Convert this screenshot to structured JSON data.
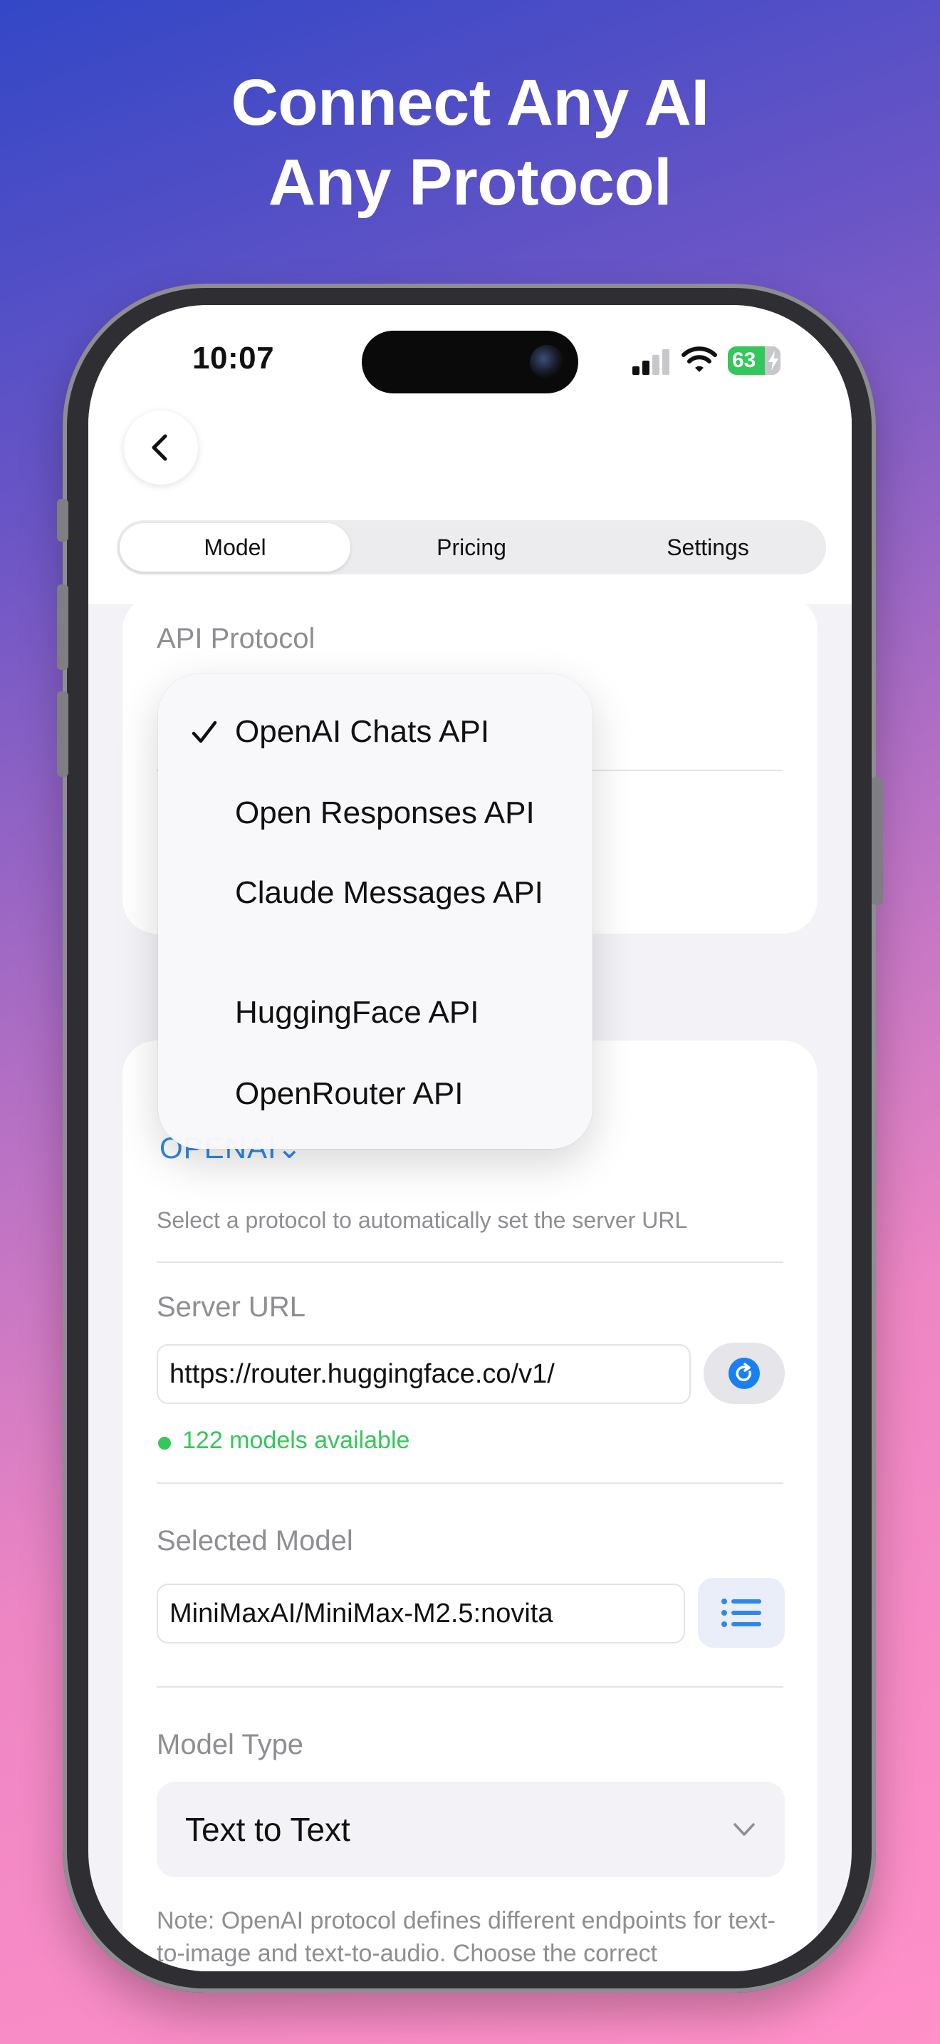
{
  "headline": {
    "line1": "Connect Any AI",
    "line2": "Any Protocol"
  },
  "status_bar": {
    "time": "10:07",
    "battery": "63"
  },
  "tabs": [
    {
      "label": "Model",
      "selected": true
    },
    {
      "label": "Pricing",
      "selected": false
    },
    {
      "label": "Settings",
      "selected": false
    }
  ],
  "api_protocol": {
    "label": "API Protocol",
    "selected_preset": "OPENAI",
    "preset_hint": "Select a protocol to automatically set the server URL"
  },
  "protocol_menu": {
    "items": [
      {
        "label": "OpenAI Chats API",
        "checked": true
      },
      {
        "label": "Open Responses API",
        "checked": false
      },
      {
        "label": "Claude Messages API",
        "checked": false
      },
      {
        "label": "HuggingFace API",
        "checked": false
      },
      {
        "label": "OpenRouter API",
        "checked": false
      }
    ]
  },
  "server": {
    "label": "Server URL",
    "value": "https://router.huggingface.co/v1/",
    "status": "122 models available"
  },
  "selected_model": {
    "label": "Selected Model",
    "value": "MiniMaxAI/MiniMax-M2.5:novita"
  },
  "model_type": {
    "label": "Model Type",
    "value": "Text to Text"
  },
  "note": "Note: OpenAI protocol defines different endpoints for text-to-image and text-to-audio. Choose the correct",
  "colors": {
    "accent": "#2f87e9",
    "success": "#34c759",
    "background_top": "#3347c6",
    "background_bottom": "#ff90c8"
  }
}
